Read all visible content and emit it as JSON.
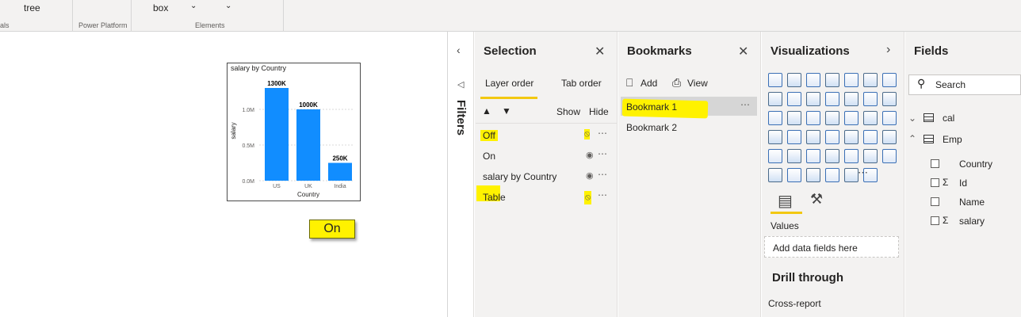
{
  "ribbon": {
    "groups": [
      {
        "items": [
          "tree"
        ],
        "label": "als"
      },
      {
        "items": [],
        "label": "Power Platform"
      },
      {
        "items": [
          "box"
        ],
        "label": "Elements"
      }
    ]
  },
  "canvas": {
    "chart_card": {
      "title": "salary by Country"
    },
    "on_button_label": "On"
  },
  "chart_data": {
    "type": "bar",
    "title": "salary by Country",
    "categories": [
      "US",
      "UK",
      "India"
    ],
    "values": [
      1300000,
      1000000,
      250000
    ],
    "data_labels": [
      "1300K",
      "1000K",
      "250K"
    ],
    "xlabel": "Country",
    "ylabel": "salary",
    "yticks": [
      "0.0M",
      "0.5M",
      "1.0M"
    ],
    "ylim": [
      0,
      1400000
    ],
    "grid": true,
    "color": "#118dff"
  },
  "filters": {
    "label": "Filters"
  },
  "selection": {
    "title": "Selection",
    "tabs": [
      "Layer order",
      "Tab order"
    ],
    "show_label": "Show",
    "hide_label": "Hide",
    "items": [
      {
        "label": "Off",
        "hidden": true,
        "highlighted": true
      },
      {
        "label": "On",
        "hidden": false,
        "highlighted": false
      },
      {
        "label": "salary by Country",
        "hidden": false,
        "highlighted": false
      },
      {
        "label": "Table",
        "hidden": true,
        "highlighted": true
      }
    ]
  },
  "bookmarks": {
    "title": "Bookmarks",
    "add_label": "Add",
    "view_label": "View",
    "items": [
      {
        "label": "Bookmark 1",
        "selected": true
      },
      {
        "label": "Bookmark 2",
        "selected": false
      }
    ]
  },
  "visualizations": {
    "title": "Visualizations",
    "values_label": "Values",
    "add_fields_placeholder": "Add data fields here",
    "drill_through_label": "Drill through",
    "cross_report_label": "Cross-report"
  },
  "fields": {
    "title": "Fields",
    "search_placeholder": "Search",
    "tables": [
      {
        "name": "cal",
        "expanded": false,
        "fields": []
      },
      {
        "name": "Emp",
        "expanded": true,
        "fields": [
          {
            "name": "Country",
            "sigma": false
          },
          {
            "name": "Id",
            "sigma": true
          },
          {
            "name": "Name",
            "sigma": false
          },
          {
            "name": "salary",
            "sigma": true
          }
        ]
      }
    ]
  },
  "colors": {
    "highlight": "#fff200",
    "accent": "#f2c811",
    "bar": "#118dff"
  }
}
